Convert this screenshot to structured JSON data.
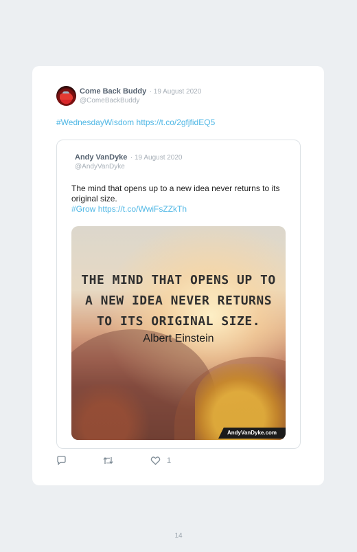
{
  "tweet": {
    "author_name": "Come Back Buddy",
    "date": "· 19 August 2020",
    "handle": "@ComeBackBuddy",
    "hashtag": "#WednesdayWisdom",
    "link": "https://t.co/2gfjfidEQ5"
  },
  "quoted": {
    "author_name": "Andy VanDyke",
    "date": "· 19 August 2020",
    "handle": "@AndyVanDyke",
    "text": "The mind that opens up to a new idea never returns to its original size.",
    "hashtag": "#Grow",
    "link": "https://t.co/WwiFsZZkTh",
    "image": {
      "quote_line1": "THE MIND THAT OPENS UP TO",
      "quote_line2": "A NEW IDEA NEVER RETURNS",
      "quote_line3": "TO ITS ORIGINAL SIZE.",
      "attribution": "Albert Einstein",
      "watermark": "AndyVanDyke.com"
    }
  },
  "actions": {
    "reply_icon": "reply-icon",
    "retweet_icon": "retweet-icon",
    "like_icon": "heart-icon",
    "like_count": "1"
  },
  "page_number": "14"
}
